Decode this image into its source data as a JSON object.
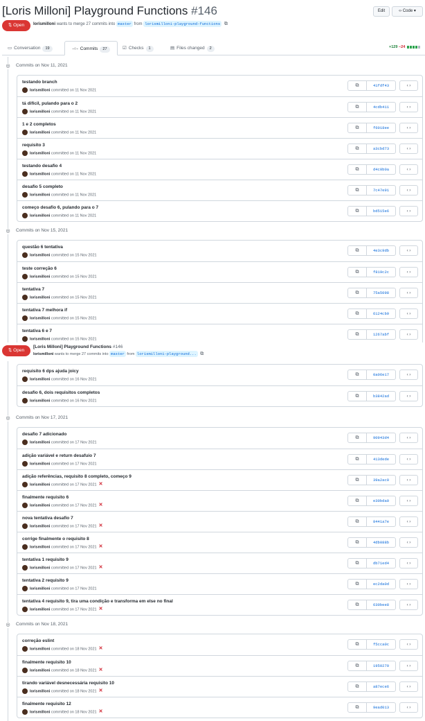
{
  "pr": {
    "title": "[Loris Milloni] Playground Functions",
    "number": "#146",
    "state": "Open",
    "author": "lorismilloni",
    "summary_mid": "wants to merge 27 commits into",
    "base": "master",
    "from": "from",
    "head": "lorismilloni-playground-functions",
    "head_short": "lorismilloni-playground..."
  },
  "header": {
    "edit_label": "Edit",
    "code_label": "Code"
  },
  "tabs": [
    {
      "label": "Conversation",
      "count": "19"
    },
    {
      "label": "Commits",
      "count": "27"
    },
    {
      "label": "Checks",
      "count": "1"
    },
    {
      "label": "Files changed",
      "count": "2"
    }
  ],
  "diffstat": {
    "additions": "+129",
    "deletions": "−24",
    "colors": [
      "#2da44e",
      "#2da44e",
      "#2da44e",
      "#2da44e",
      "#afb8c1"
    ]
  },
  "icons": [
    "git-pull-request-icon",
    "git-commit-icon",
    "copy-icon",
    "code-icon",
    "x-icon",
    "comment-icon",
    "checklist-icon",
    "file-diff-icon"
  ],
  "colors": {
    "open": "#da3633",
    "link": "#0969da",
    "fail": "#cf222e",
    "add": "#1a7f37"
  },
  "commit_meta_text": "committed on",
  "groups": [
    {
      "date": "Commits on Nov 11, 2021",
      "commits": [
        {
          "msg": "testando branch",
          "author": "lorismilloni",
          "date": "11 Nov 2021",
          "sha": "41fdf43",
          "fail": false
        },
        {
          "msg": "tá difícil, pulando para o 2",
          "author": "lorismilloni",
          "date": "11 Nov 2021",
          "sha": "4cdb411",
          "fail": false
        },
        {
          "msg": "1 e 2 completos",
          "author": "lorismilloni",
          "date": "11 Nov 2021",
          "sha": "f6018ee",
          "fail": false
        },
        {
          "msg": "requisito 3",
          "author": "lorismilloni",
          "date": "11 Nov 2021",
          "sha": "a3cbd73",
          "fail": false
        },
        {
          "msg": "testando desafio 4",
          "author": "lorismilloni",
          "date": "11 Nov 2021",
          "sha": "d4c0b0a",
          "fail": false
        },
        {
          "msg": "desafio 5 completo",
          "author": "lorismilloni",
          "date": "11 Nov 2021",
          "sha": "7c47e91",
          "fail": false
        },
        {
          "msg": "começo desafio 6, pulando para o 7",
          "author": "lorismilloni",
          "date": "11 Nov 2021",
          "sha": "bd515e6",
          "fail": false
        }
      ]
    },
    {
      "date": "Commits on Nov 15, 2021",
      "commits": [
        {
          "msg": "questão 6 tentativa",
          "author": "lorismilloni",
          "date": "15 Nov 2021",
          "sha": "4e3c9db",
          "fail": false
        },
        {
          "msg": "teste correção 6",
          "author": "lorismilloni",
          "date": "15 Nov 2021",
          "sha": "f819c2c",
          "fail": false
        },
        {
          "msg": "tentativa 7",
          "author": "lorismilloni",
          "date": "15 Nov 2021",
          "sha": "75a5098",
          "fail": false
        },
        {
          "msg": "tentativa 7 melhora if",
          "author": "lorismilloni",
          "date": "15 Nov 2021",
          "sha": "6124cb9",
          "fail": false
        },
        {
          "msg": "tentativa 6 e 7",
          "author": "lorismilloni",
          "date": "15 Nov 2021",
          "sha": "1267abf",
          "fail": false
        }
      ]
    },
    {
      "date": "",
      "commits": [
        {
          "msg": "requisito 6 dps ajuda joicy",
          "author": "lorismilloni",
          "date": "16 Nov 2021",
          "sha": "0a06e17",
          "fail": false
        },
        {
          "msg": "desafio 6, dois requisitos completos",
          "author": "lorismilloni",
          "date": "16 Nov 2021",
          "sha": "b3842ad",
          "fail": false
        }
      ]
    },
    {
      "date": "Commits on Nov 17, 2021",
      "commits": [
        {
          "msg": "desafio 7 adicionado",
          "author": "lorismilloni",
          "date": "17 Nov 2021",
          "sha": "90943d4",
          "fail": false
        },
        {
          "msg": "adição variável e return desafuio 7",
          "author": "lorismilloni",
          "date": "17 Nov 2021",
          "sha": "413dede",
          "fail": false
        },
        {
          "msg": "adição referências, requisito 8 completo, começo 9",
          "author": "lorismilloni",
          "date": "17 Nov 2021",
          "sha": "39a2ac0",
          "fail": true
        },
        {
          "msg": "finalmente requisito 6",
          "author": "lorismilloni",
          "date": "17 Nov 2021",
          "sha": "e30bda0",
          "fail": true
        },
        {
          "msg": "nova tentativa desafio 7",
          "author": "lorismilloni",
          "date": "17 Nov 2021",
          "sha": "8441a7e",
          "fail": true
        },
        {
          "msg": "corrige finalmente o requisito 8",
          "author": "lorismilloni",
          "date": "17 Nov 2021",
          "sha": "4db088b",
          "fail": true
        },
        {
          "msg": "tentativa 1 requisito 9",
          "author": "lorismilloni",
          "date": "17 Nov 2021",
          "sha": "db71ed4",
          "fail": true
        },
        {
          "msg": "tentativa 2 requisito 9",
          "author": "lorismilloni",
          "date": "17 Nov 2021",
          "sha": "ec2da0d",
          "fail": false
        },
        {
          "msg": "tentativa 4 requisito 9, tira uma condição e transforma em else no final",
          "author": "lorismilloni",
          "date": "17 Nov 2021",
          "sha": "630bee8",
          "fail": true
        }
      ]
    },
    {
      "date": "Commits on Nov 18, 2021",
      "commits": [
        {
          "msg": "correção eslint",
          "author": "lorismilloni",
          "date": "18 Nov 2021",
          "sha": "f5cca0c",
          "fail": true
        },
        {
          "msg": "finalmente requisito 10",
          "author": "lorismilloni",
          "date": "18 Nov 2021",
          "sha": "1950270",
          "fail": true
        },
        {
          "msg": "tirando variável desnecessária requisito 10",
          "author": "lorismilloni",
          "date": "18 Nov 2021",
          "sha": "a87ece6",
          "fail": true
        },
        {
          "msg": "finalmente requisito 12",
          "author": "lorismilloni",
          "date": "18 Nov 2021",
          "sha": "9ead013",
          "fail": true
        }
      ]
    }
  ]
}
